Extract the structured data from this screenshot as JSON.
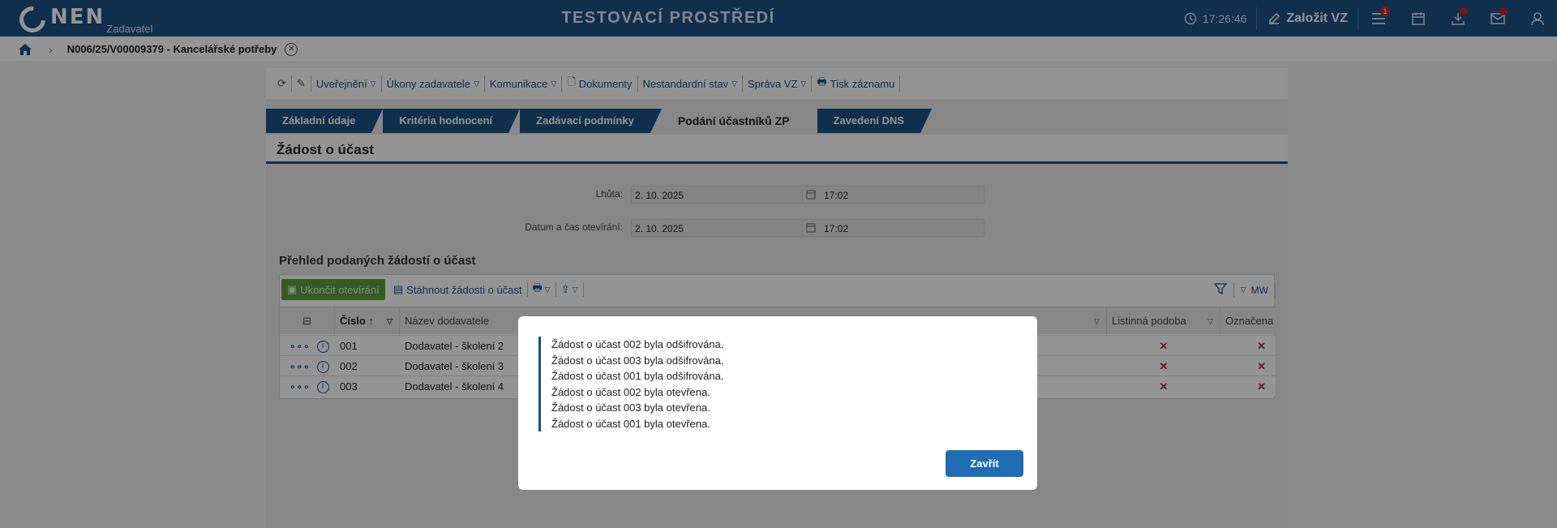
{
  "header": {
    "logo_text": "NEN",
    "logo_sub": "Zadavatel",
    "env_title": "TESTOVACÍ PROSTŘEDÍ",
    "time": "17:26:46",
    "create_label": "Založit VZ",
    "menu_badge": "1",
    "colors": {
      "bar": "#1a5183",
      "badge": "#d4212a"
    }
  },
  "breadcrumb": {
    "title": "N006/25/V00009379 - Kancelářské potřeby"
  },
  "toolbar": {
    "items": [
      "Uveřejnění",
      "Úkony zadavatele",
      "Komunikace",
      "Dokumenty",
      "Nestandardní stav",
      "Správa VZ",
      "Tisk záznamu"
    ]
  },
  "tabs": [
    "Základní údaje",
    "Kritéria hodnocení",
    "Zadávací podmínky",
    "Podání účastníků ZP",
    "Zavedení DNS"
  ],
  "section": {
    "title": "Žádost o účast",
    "deadline_label": "Lhůta:",
    "deadline_date": "2. 10. 2025",
    "deadline_time": "17:02",
    "opening_label": "Datum a čas otevírání:",
    "opening_date": "2. 10. 2025",
    "opening_time": "17:02"
  },
  "grid": {
    "title": "Přehled podaných žádostí o účast",
    "end_opening_label": "Ukončit otevírání",
    "download_label": "Stáhnout žádosti o účast",
    "mw_label": "MW",
    "columns": {
      "number": "Číslo",
      "supplier": "Název dodavatele",
      "paper": "Listinná podoba",
      "marked": "Označena jako ne"
    },
    "rows": [
      {
        "number": "001",
        "supplier": "Dodavatel - školení 2"
      },
      {
        "number": "002",
        "supplier": "Dodavatel - školení 3"
      },
      {
        "number": "003",
        "supplier": "Dodavatel - školení 4"
      }
    ]
  },
  "modal": {
    "messages": [
      "Žádost o účast 002 byla odšifrována.",
      "Žádost o účast 003 byla odšifrována.",
      "Žádost o účast 001 byla odšifrována.",
      "Žádost o účast 002 byla otevřena.",
      "Žádost o účast 003 byla otevřena.",
      "Žádost o účast 001 byla otevřena."
    ],
    "close_label": "Zavřít"
  }
}
